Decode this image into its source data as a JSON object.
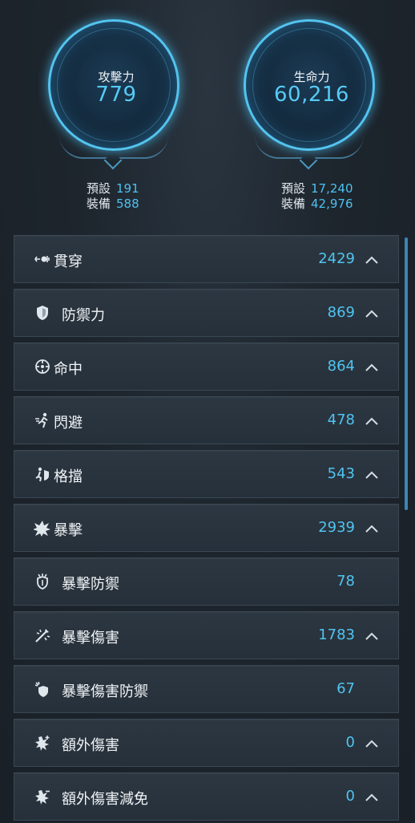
{
  "attack": {
    "label": "攻擊力",
    "value": "779",
    "default_label": "預設",
    "default_value": "191",
    "equip_label": "裝備",
    "equip_value": "588"
  },
  "hp": {
    "label": "生命力",
    "value": "60,216",
    "default_label": "預設",
    "default_value": "17,240",
    "equip_label": "裝備",
    "equip_value": "42,976"
  },
  "stats": [
    {
      "label": "貫穿",
      "value": "2429",
      "icon": "piercing-icon",
      "expandable": true
    },
    {
      "label": "防禦力",
      "value": "869",
      "icon": "shield-icon",
      "expandable": true
    },
    {
      "label": "命中",
      "value": "864",
      "icon": "crosshair-icon",
      "expandable": true
    },
    {
      "label": "閃避",
      "value": "478",
      "icon": "evasion-icon",
      "expandable": true
    },
    {
      "label": "格擋",
      "value": "543",
      "icon": "block-icon",
      "expandable": true
    },
    {
      "label": "暴擊",
      "value": "2939",
      "icon": "critical-icon",
      "expandable": true
    },
    {
      "label": "暴擊防禦",
      "value": "78",
      "icon": "critical-defense-icon",
      "expandable": false
    },
    {
      "label": "暴擊傷害",
      "value": "1783",
      "icon": "critical-damage-icon",
      "expandable": true
    },
    {
      "label": "暴擊傷害防禦",
      "value": "67",
      "icon": "critical-damage-defense-icon",
      "expandable": false
    },
    {
      "label": "額外傷害",
      "value": "0",
      "icon": "additional-damage-icon",
      "expandable": true
    },
    {
      "label": "額外傷害減免",
      "value": "0",
      "icon": "damage-reduction-icon",
      "expandable": true
    }
  ],
  "colors": {
    "accent": "#4fc4f1",
    "panel": "#2a343e",
    "background": "#1c232b"
  }
}
